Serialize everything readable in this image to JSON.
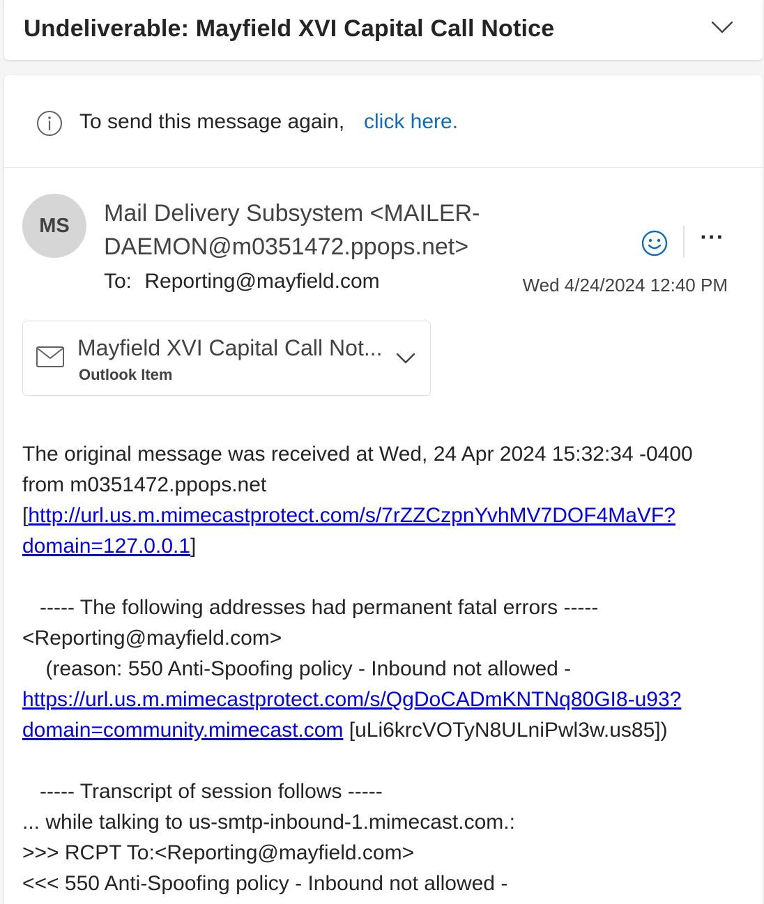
{
  "subject": {
    "title": "Undeliverable: Mayfield XVI Capital Call Notice"
  },
  "info_bar": {
    "text": "To send this message again,",
    "link": "click here."
  },
  "message": {
    "avatar_initials": "MS",
    "sender_line1": "Mail Delivery Subsystem <MAILER-",
    "sender_line2": "DAEMON@m0351472.ppops.net>",
    "to_label": "To:",
    "to_value": "Reporting@mayfield.com",
    "date": "Wed 4/24/2024 12:40 PM"
  },
  "attachment": {
    "name": "Mayfield XVI Capital Call Not...",
    "type": "Outlook Item"
  },
  "body": {
    "p1_line1": "The original message was received at Wed, 24 Apr 2024 15:32:34 -0400",
    "p1_line2": "from m0351472.ppops.net",
    "p1_bracket_open": "[",
    "p1_link_line1": "http://url.us.m.mimecastprotect.com/s/7rZZCzpnYvhMV7DOF4MaVF?",
    "p1_link_line2": "domain=127.0.0.1",
    "p1_bracket_close": "]",
    "p2_line1": "   ----- The following addresses had permanent fatal errors -----",
    "p2_line2": "<Reporting@mayfield.com>",
    "p2_line3": "    (reason: 550 Anti-Spoofing policy - Inbound not allowed -",
    "p2_link_line1": "https://url.us.m.mimecastprotect.com/s/QgDoCADmKNTNq80GI8-u93?",
    "p2_link_line2": "domain=community.mimecast.com",
    "p2_tail": " [uLi6krcVOTyN8ULniPwl3w.us85])",
    "p3_line1": "   ----- Transcript of session follows -----",
    "p3_line2": "... while talking to us-smtp-inbound-1.mimecast.com.:",
    "p3_line3": ">>> RCPT To:<Reporting@mayfield.com>",
    "p3_line4": "<<< 550 Anti-Spoofing policy - Inbound not allowed -"
  },
  "colors": {
    "accent": "#0f6cbd",
    "link": "#0000ee",
    "avatar_bg": "#d6d6d6",
    "page_bg": "#f5f5f5"
  },
  "icons": [
    "chevron-down-icon",
    "info-icon",
    "smiley-icon",
    "more-icon",
    "mail-icon"
  ]
}
